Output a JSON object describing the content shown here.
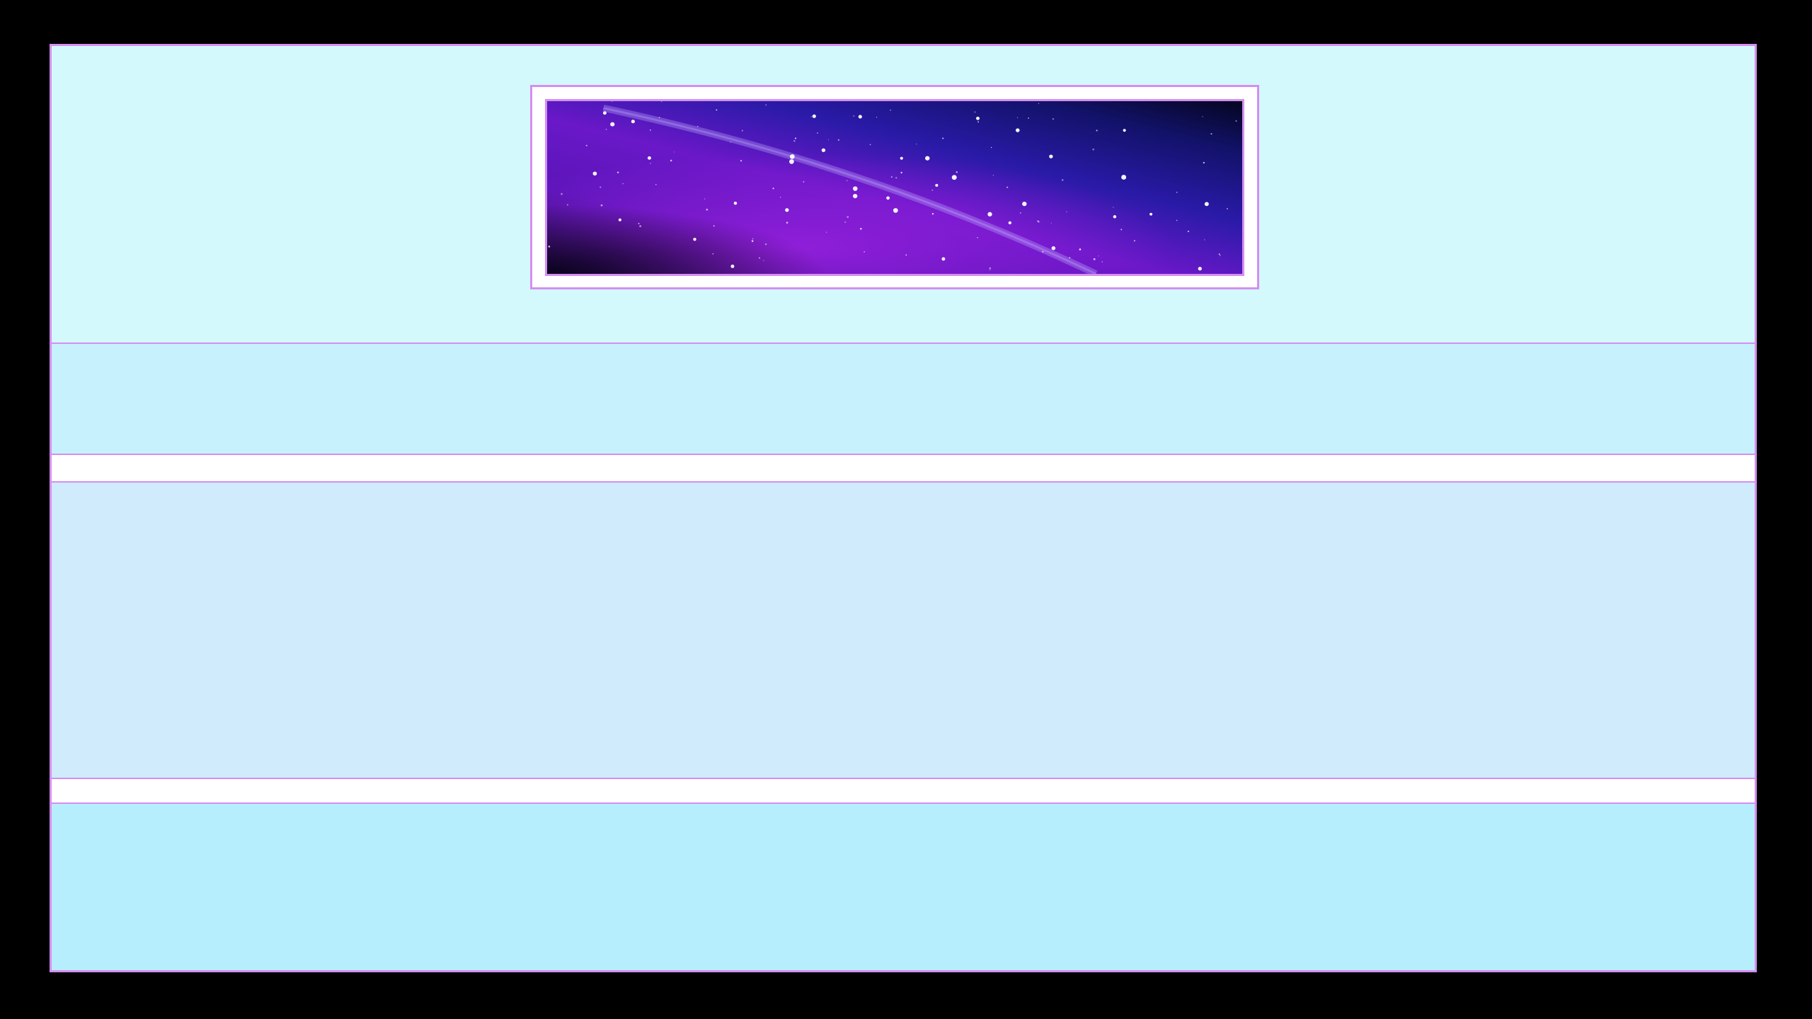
{
  "colors": {
    "background": "#000000",
    "border": "#d58ef0",
    "header_bg": "#d3f9fd",
    "band_1_bg": "#c7f1fd",
    "divider_bg": "#ffffff",
    "content_bg": "#cfebfc",
    "footer_bg": "#b7eefd",
    "banner_frame_bg": "#ffffff"
  },
  "banner": {
    "image_description_icon": "starry-galaxy-image"
  }
}
